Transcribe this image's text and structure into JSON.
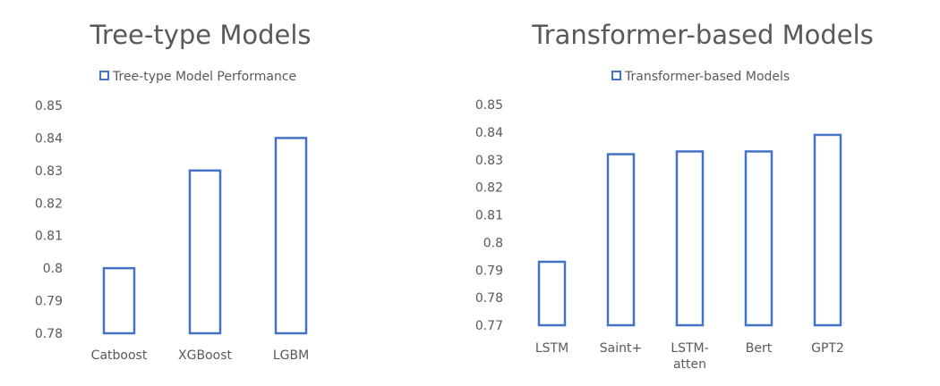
{
  "chart_data": [
    {
      "type": "bar",
      "title": "Tree-type Models",
      "legend": {
        "label": "Tree-type Model Performance",
        "position": "top"
      },
      "categories": [
        "Catboost",
        "XGBoost",
        "LGBM"
      ],
      "series": [
        {
          "name": "Tree-type Model Performance",
          "values": [
            0.8,
            0.83,
            0.84
          ]
        }
      ],
      "xlabel": "",
      "ylabel": "",
      "ylim": [
        0.78,
        0.85
      ],
      "yticks": [
        "0.78",
        "0.79",
        "0.8",
        "0.81",
        "0.82",
        "0.83",
        "0.84",
        "0.85"
      ],
      "grid": false,
      "bar_style": "outline",
      "bar_color": "#4472C4"
    },
    {
      "type": "bar",
      "title": "Transformer-based Models",
      "legend": {
        "label": "Transformer-based Models",
        "position": "top"
      },
      "categories": [
        "LSTM",
        "Saint+",
        "LSTM-atten",
        "Bert",
        "GPT2"
      ],
      "category_lines": [
        [
          "LSTM"
        ],
        [
          "Saint+"
        ],
        [
          "LSTM-",
          "atten"
        ],
        [
          "Bert"
        ],
        [
          "GPT2"
        ]
      ],
      "series": [
        {
          "name": "Transformer-based Models",
          "values": [
            0.793,
            0.832,
            0.833,
            0.833,
            0.839
          ]
        }
      ],
      "xlabel": "",
      "ylabel": "",
      "ylim": [
        0.77,
        0.85
      ],
      "yticks": [
        "0.77",
        "0.78",
        "0.79",
        "0.8",
        "0.81",
        "0.82",
        "0.83",
        "0.84",
        "0.85"
      ],
      "grid": false,
      "bar_style": "outline",
      "bar_color": "#4472C4"
    }
  ],
  "colors": {
    "bar_outline": "#4472C4",
    "title_text": "#595959",
    "tick_text": "#595959",
    "background": "#FFFFFF"
  }
}
